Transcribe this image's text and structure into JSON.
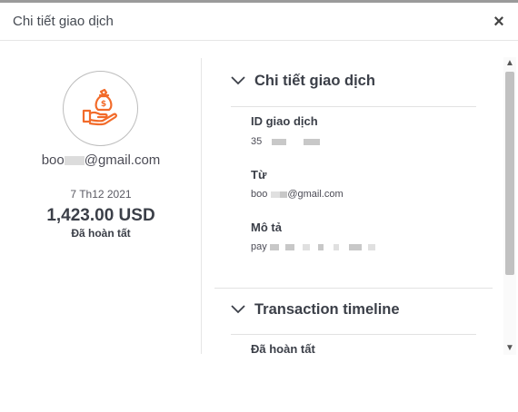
{
  "header": {
    "title": "Chi tiết giao dịch",
    "close_icon": "×"
  },
  "summary": {
    "avatar_icon": "money-bag-hand-icon",
    "email_prefix": "boo",
    "email_suffix": "@gmail.com",
    "date": "7 Th12 2021",
    "amount": "1,423.00 USD",
    "status": "Đã hoàn tất"
  },
  "details": {
    "section_title": "Chi tiết giao dịch",
    "id_label": "ID giao dịch",
    "id_value_prefix": "35",
    "from_label": "Từ",
    "from_prefix": "boo",
    "from_suffix": "@gmail.com",
    "desc_label": "Mô tả",
    "desc_prefix": "pay"
  },
  "timeline": {
    "section_title": "Transaction timeline",
    "first_item": "Đã hoàn tất"
  },
  "colors": {
    "accent": "#f26b2a",
    "text": "#3b3f48",
    "divider": "#e2e2e2"
  }
}
